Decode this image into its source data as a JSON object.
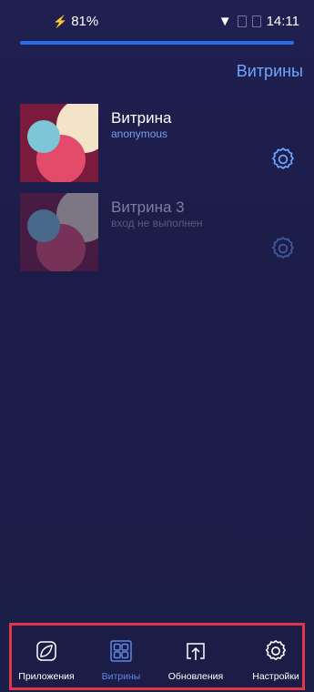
{
  "status_bar": {
    "battery": "81%",
    "time": "14:11"
  },
  "page_title": "Витрины",
  "stores": [
    {
      "name": "Витрина",
      "status": "anonymous"
    },
    {
      "name": "Витрина 3",
      "status": "вход не выполнен"
    }
  ],
  "nav": {
    "items": [
      {
        "label": "Приложения",
        "icon": "leaf-icon"
      },
      {
        "label": "Витрины",
        "icon": "grid-icon"
      },
      {
        "label": "Обновления",
        "icon": "upload-icon"
      },
      {
        "label": "Настройки",
        "icon": "gear-icon"
      }
    ]
  },
  "colors": {
    "accent": "#6ea6ff",
    "active": "#5d87e8",
    "highlight_border": "#e0364b"
  }
}
